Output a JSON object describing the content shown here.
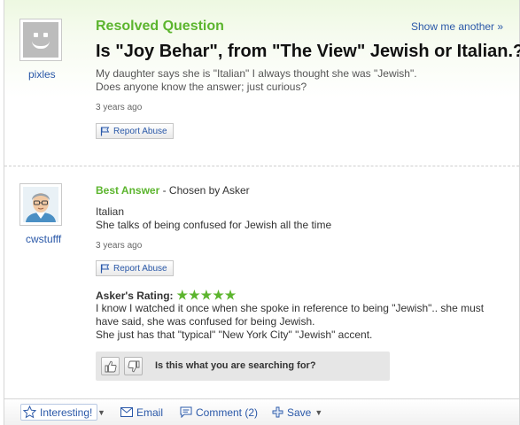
{
  "question": {
    "status_title": "Resolved Question",
    "show_another_label": "Show me another »",
    "title": "Is \"Joy Behar\", from \"The View\" Jewish or Italian.?",
    "body_line1": "My daughter says she is \"Italian\" I always thought she was \"Jewish\".",
    "body_line2": "Does anyone know the answer; just curious?",
    "timestamp": "3 years ago",
    "report_label": "Report Abuse",
    "asker_name": "pixles"
  },
  "answer": {
    "best_answer_label": "Best Answer",
    "chosen_by": "- Chosen by Asker",
    "body_line1": "Italian",
    "body_line2": "She talks of being confused for Jewish all the time",
    "timestamp": "3 years ago",
    "report_label": "Report Abuse",
    "answerer_name": "cwstufff",
    "rating_label": "Asker's Rating:",
    "rating_stars": 5,
    "rating_stars_text": "★★★★★",
    "rating_comment_line1": "I know I watched it once when she spoke in reference to being \"Jewish\".. she must",
    "rating_comment_line2": "have said, she was confused for being Jewish.",
    "rating_comment_line3": "She just has that \"typical\" \"New York City\" \"Jewish\" accent.",
    "search_question": "Is this what you are searching for?"
  },
  "toolbar": {
    "interesting_label": "Interesting!",
    "email_label": "Email",
    "comment_label": "Comment (2)",
    "save_label": "Save"
  },
  "colors": {
    "accent_green": "#5cb52e",
    "link_blue": "#2a58a8"
  },
  "icons": [
    "default-avatar-icon",
    "flag-icon",
    "star-icon",
    "thumbs-up-icon",
    "thumbs-down-icon",
    "envelope-icon",
    "comment-bubble-icon",
    "plus-save-icon",
    "caret-down-icon"
  ]
}
